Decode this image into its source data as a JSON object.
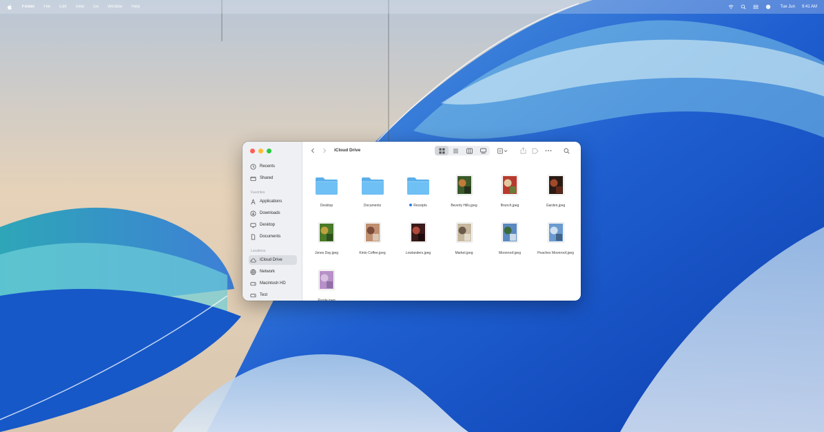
{
  "menubar": {
    "app": "Finder",
    "menus": [
      "File",
      "Edit",
      "View",
      "Go",
      "Window",
      "Help"
    ],
    "date": "Tue Jun",
    "time": "9:41 AM"
  },
  "window": {
    "title": "iCloud Drive",
    "sidebar": {
      "favorites": [
        {
          "label": "Recents",
          "icon": "clock-icon"
        },
        {
          "label": "Shared",
          "icon": "shared-folder-icon"
        }
      ],
      "favorites_header": "Favorites",
      "places": [
        {
          "label": "Applications",
          "icon": "applications-icon"
        },
        {
          "label": "Downloads",
          "icon": "downloads-icon"
        },
        {
          "label": "Desktop",
          "icon": "desktop-icon"
        },
        {
          "label": "Documents",
          "icon": "document-icon"
        }
      ],
      "locations_header": "Locations",
      "locations": [
        {
          "label": "iCloud Drive",
          "icon": "cloud-icon",
          "active": true
        },
        {
          "label": "Network",
          "icon": "network-icon"
        },
        {
          "label": "Macintosh HD",
          "icon": "disk-icon"
        },
        {
          "label": "Test",
          "icon": "disk-icon"
        }
      ]
    },
    "files": [
      {
        "name": "Desktop",
        "kind": "folder"
      },
      {
        "name": "Documents",
        "kind": "folder"
      },
      {
        "name": "Receipts",
        "kind": "folder",
        "tag": true
      },
      {
        "name": "Beverly Hills.jpeg",
        "kind": "image",
        "colors": [
          "#3a5a2a",
          "#c07a3a",
          "#1e2a1a"
        ]
      },
      {
        "name": "Brunch.jpeg",
        "kind": "image",
        "colors": [
          "#b83a2e",
          "#e0c9a0",
          "#5a8a3a"
        ]
      },
      {
        "name": "Garden.jpeg",
        "kind": "image",
        "colors": [
          "#2a1a14",
          "#a04a2a",
          "#6a2a1a"
        ]
      },
      {
        "name": "Jones Day.jpeg",
        "kind": "image",
        "colors": [
          "#4a7a2a",
          "#c0a040",
          "#2a4a1a"
        ]
      },
      {
        "name": "Kinto Coffee.jpeg",
        "kind": "image",
        "colors": [
          "#c09070",
          "#7a4a3a",
          "#e0d0c0"
        ]
      },
      {
        "name": "Lowlanders.jpeg",
        "kind": "image",
        "colors": [
          "#3a1a1a",
          "#b04a3a",
          "#1a0a0a"
        ]
      },
      {
        "name": "Market.jpeg",
        "kind": "image",
        "colors": [
          "#c8b8a0",
          "#6a5a4a",
          "#e8e0d0"
        ]
      },
      {
        "name": "Moonroof.jpeg",
        "kind": "image",
        "colors": [
          "#5a8ac0",
          "#3a6a3a",
          "#e0e8f0"
        ]
      },
      {
        "name": "Peaches Moonroof.jpeg",
        "kind": "image",
        "colors": [
          "#6a9ad0",
          "#d0e0f0",
          "#3a5a7a"
        ]
      },
      {
        "name": "Purple.jpeg",
        "kind": "image",
        "colors": [
          "#b890c8",
          "#d8c0e0",
          "#8a6aa0"
        ]
      }
    ]
  }
}
